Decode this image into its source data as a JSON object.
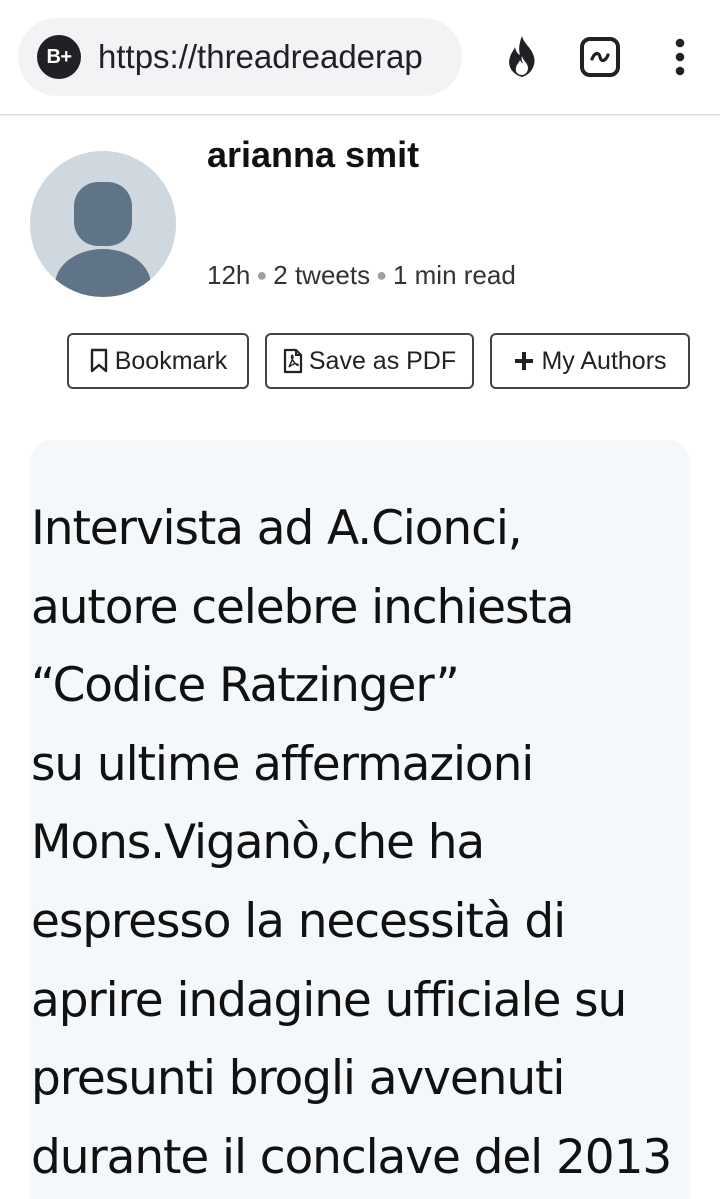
{
  "browser": {
    "site_badge": "B+",
    "url": "https://threadreaderap",
    "icons": {
      "fire": "fire-icon",
      "tab": "tab-switcher-icon",
      "menu": "more-vert-icon"
    }
  },
  "author": {
    "name": "arianna smit",
    "time": "12h",
    "tweets": "2 tweets",
    "read_time": "1 min read"
  },
  "actions": {
    "bookmark_label": "Bookmark",
    "pdf_label": "Save as PDF",
    "authors_label": "My Authors"
  },
  "tweet": {
    "text": "Intervista ad A.Cionci,\nautore celebre inchiesta\n“Codice Ratzinger”\nsu ultime affermazioni\nMons.Viganò,che ha\nespresso la necessità di\naprire indagine ufficiale su\npresunti brogli avvenuti\ndurante il conclave del 2013"
  },
  "colors": {
    "card_bg": "#f5f8fa",
    "avatar_bg": "#cfd8de",
    "avatar_silhouette": "#5f7587",
    "url_bar_bg": "#f1f3f4"
  }
}
